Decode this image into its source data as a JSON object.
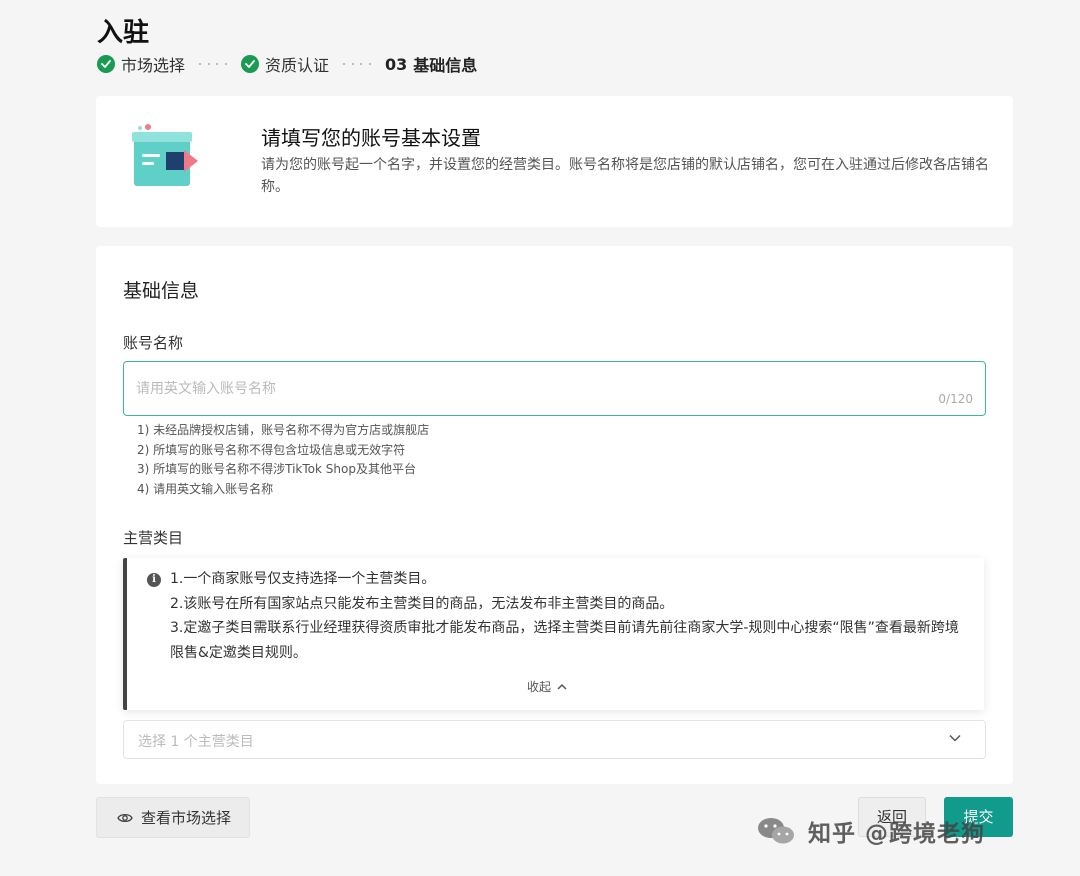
{
  "page": {
    "title": "入驻"
  },
  "steps": [
    {
      "label": "市场选择",
      "status": "done"
    },
    {
      "label": "资质认证",
      "status": "done"
    },
    {
      "number": "03",
      "label": "基础信息",
      "status": "current"
    }
  ],
  "intro": {
    "title": "请填写您的账号基本设置",
    "description": "请为您的账号起一个名字，并设置您的经营类目。账号名称将是您店铺的默认店铺名，您可在入驻通过后修改各店铺名称。"
  },
  "form": {
    "section_title": "基础信息",
    "account_name": {
      "label": "账号名称",
      "placeholder": "请用英文输入账号名称",
      "value": "",
      "counter": "0/120",
      "rules": [
        "1) 未经品牌授权店铺，账号名称不得为官方店或旗舰店",
        "2) 所填写的账号名称不得包含垃圾信息或无效字符",
        "3) 所填写的账号名称不得涉TikTok Shop及其他平台",
        "4) 请用英文输入账号名称"
      ]
    },
    "main_category": {
      "label": "主营类目",
      "notice_lines": [
        "1.一个商家账号仅支持选择一个主营类目。",
        "2.该账号在所有国家站点只能发布主营类目的商品，无法发布非主营类目的商品。",
        "3.定邀子类目需联系行业经理获得资质审批才能发布商品，选择主营类目前请先前往商家大学-规则中心搜索“限售”查看最新跨境限售&定邀类目规则。"
      ],
      "collapse_label": "收起",
      "select_placeholder": "选择 1 个主营类目"
    }
  },
  "footer": {
    "view_market_label": "查看市场选择",
    "back_label": "返回",
    "submit_label": "提交"
  },
  "watermark": {
    "text": "知乎 @跨境老狗"
  },
  "colors": {
    "accent": "#119b8c",
    "success": "#1a9a52",
    "focus_border": "#3fb69a"
  },
  "icons": [
    "check-circle-icon",
    "info-icon",
    "chevron-up-icon",
    "chevron-down-icon",
    "eye-icon",
    "wechat-icon",
    "box-illustration"
  ]
}
